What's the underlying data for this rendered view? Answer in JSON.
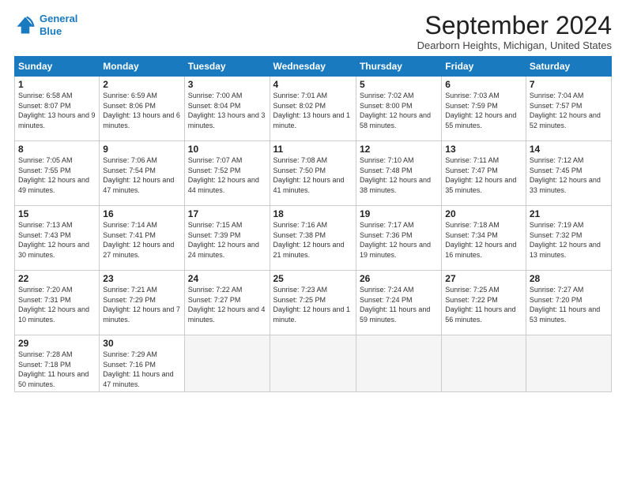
{
  "logo": {
    "line1": "General",
    "line2": "Blue"
  },
  "title": "September 2024",
  "subtitle": "Dearborn Heights, Michigan, United States",
  "weekdays": [
    "Sunday",
    "Monday",
    "Tuesday",
    "Wednesday",
    "Thursday",
    "Friday",
    "Saturday"
  ],
  "days": [
    {
      "num": "",
      "info": ""
    },
    {
      "num": "",
      "info": ""
    },
    {
      "num": "",
      "info": ""
    },
    {
      "num": "",
      "info": ""
    },
    {
      "num": "",
      "info": ""
    },
    {
      "num": "",
      "info": ""
    },
    {
      "num": "7",
      "sunrise": "Sunrise: 7:04 AM",
      "sunset": "Sunset: 7:57 PM",
      "daylight": "Daylight: 12 hours and 52 minutes."
    },
    {
      "num": "8",
      "sunrise": "Sunrise: 7:05 AM",
      "sunset": "Sunset: 7:55 PM",
      "daylight": "Daylight: 12 hours and 49 minutes."
    },
    {
      "num": "9",
      "sunrise": "Sunrise: 7:06 AM",
      "sunset": "Sunset: 7:54 PM",
      "daylight": "Daylight: 12 hours and 47 minutes."
    },
    {
      "num": "10",
      "sunrise": "Sunrise: 7:07 AM",
      "sunset": "Sunset: 7:52 PM",
      "daylight": "Daylight: 12 hours and 44 minutes."
    },
    {
      "num": "11",
      "sunrise": "Sunrise: 7:08 AM",
      "sunset": "Sunset: 7:50 PM",
      "daylight": "Daylight: 12 hours and 41 minutes."
    },
    {
      "num": "12",
      "sunrise": "Sunrise: 7:10 AM",
      "sunset": "Sunset: 7:48 PM",
      "daylight": "Daylight: 12 hours and 38 minutes."
    },
    {
      "num": "13",
      "sunrise": "Sunrise: 7:11 AM",
      "sunset": "Sunset: 7:47 PM",
      "daylight": "Daylight: 12 hours and 35 minutes."
    },
    {
      "num": "14",
      "sunrise": "Sunrise: 7:12 AM",
      "sunset": "Sunset: 7:45 PM",
      "daylight": "Daylight: 12 hours and 33 minutes."
    },
    {
      "num": "15",
      "sunrise": "Sunrise: 7:13 AM",
      "sunset": "Sunset: 7:43 PM",
      "daylight": "Daylight: 12 hours and 30 minutes."
    },
    {
      "num": "16",
      "sunrise": "Sunrise: 7:14 AM",
      "sunset": "Sunset: 7:41 PM",
      "daylight": "Daylight: 12 hours and 27 minutes."
    },
    {
      "num": "17",
      "sunrise": "Sunrise: 7:15 AM",
      "sunset": "Sunset: 7:39 PM",
      "daylight": "Daylight: 12 hours and 24 minutes."
    },
    {
      "num": "18",
      "sunrise": "Sunrise: 7:16 AM",
      "sunset": "Sunset: 7:38 PM",
      "daylight": "Daylight: 12 hours and 21 minutes."
    },
    {
      "num": "19",
      "sunrise": "Sunrise: 7:17 AM",
      "sunset": "Sunset: 7:36 PM",
      "daylight": "Daylight: 12 hours and 19 minutes."
    },
    {
      "num": "20",
      "sunrise": "Sunrise: 7:18 AM",
      "sunset": "Sunset: 7:34 PM",
      "daylight": "Daylight: 12 hours and 16 minutes."
    },
    {
      "num": "21",
      "sunrise": "Sunrise: 7:19 AM",
      "sunset": "Sunset: 7:32 PM",
      "daylight": "Daylight: 12 hours and 13 minutes."
    },
    {
      "num": "22",
      "sunrise": "Sunrise: 7:20 AM",
      "sunset": "Sunset: 7:31 PM",
      "daylight": "Daylight: 12 hours and 10 minutes."
    },
    {
      "num": "23",
      "sunrise": "Sunrise: 7:21 AM",
      "sunset": "Sunset: 7:29 PM",
      "daylight": "Daylight: 12 hours and 7 minutes."
    },
    {
      "num": "24",
      "sunrise": "Sunrise: 7:22 AM",
      "sunset": "Sunset: 7:27 PM",
      "daylight": "Daylight: 12 hours and 4 minutes."
    },
    {
      "num": "25",
      "sunrise": "Sunrise: 7:23 AM",
      "sunset": "Sunset: 7:25 PM",
      "daylight": "Daylight: 12 hours and 1 minute."
    },
    {
      "num": "26",
      "sunrise": "Sunrise: 7:24 AM",
      "sunset": "Sunset: 7:24 PM",
      "daylight": "Daylight: 11 hours and 59 minutes."
    },
    {
      "num": "27",
      "sunrise": "Sunrise: 7:25 AM",
      "sunset": "Sunset: 7:22 PM",
      "daylight": "Daylight: 11 hours and 56 minutes."
    },
    {
      "num": "28",
      "sunrise": "Sunrise: 7:27 AM",
      "sunset": "Sunset: 7:20 PM",
      "daylight": "Daylight: 11 hours and 53 minutes."
    },
    {
      "num": "29",
      "sunrise": "Sunrise: 7:28 AM",
      "sunset": "Sunset: 7:18 PM",
      "daylight": "Daylight: 11 hours and 50 minutes."
    },
    {
      "num": "30",
      "sunrise": "Sunrise: 7:29 AM",
      "sunset": "Sunset: 7:16 PM",
      "daylight": "Daylight: 11 hours and 47 minutes."
    },
    {
      "num": "",
      "info": ""
    },
    {
      "num": "",
      "info": ""
    },
    {
      "num": "",
      "info": ""
    },
    {
      "num": "",
      "info": ""
    },
    {
      "num": "",
      "info": ""
    }
  ],
  "row0": [
    {
      "num": "1",
      "sunrise": "Sunrise: 6:58 AM",
      "sunset": "Sunset: 8:07 PM",
      "daylight": "Daylight: 13 hours and 9 minutes."
    },
    {
      "num": "2",
      "sunrise": "Sunrise: 6:59 AM",
      "sunset": "Sunset: 8:06 PM",
      "daylight": "Daylight: 13 hours and 6 minutes."
    },
    {
      "num": "3",
      "sunrise": "Sunrise: 7:00 AM",
      "sunset": "Sunset: 8:04 PM",
      "daylight": "Daylight: 13 hours and 3 minutes."
    },
    {
      "num": "4",
      "sunrise": "Sunrise: 7:01 AM",
      "sunset": "Sunset: 8:02 PM",
      "daylight": "Daylight: 13 hours and 1 minute."
    },
    {
      "num": "5",
      "sunrise": "Sunrise: 7:02 AM",
      "sunset": "Sunset: 8:00 PM",
      "daylight": "Daylight: 12 hours and 58 minutes."
    },
    {
      "num": "6",
      "sunrise": "Sunrise: 7:03 AM",
      "sunset": "Sunset: 7:59 PM",
      "daylight": "Daylight: 12 hours and 55 minutes."
    },
    {
      "num": "7",
      "sunrise": "Sunrise: 7:04 AM",
      "sunset": "Sunset: 7:57 PM",
      "daylight": "Daylight: 12 hours and 52 minutes."
    }
  ]
}
